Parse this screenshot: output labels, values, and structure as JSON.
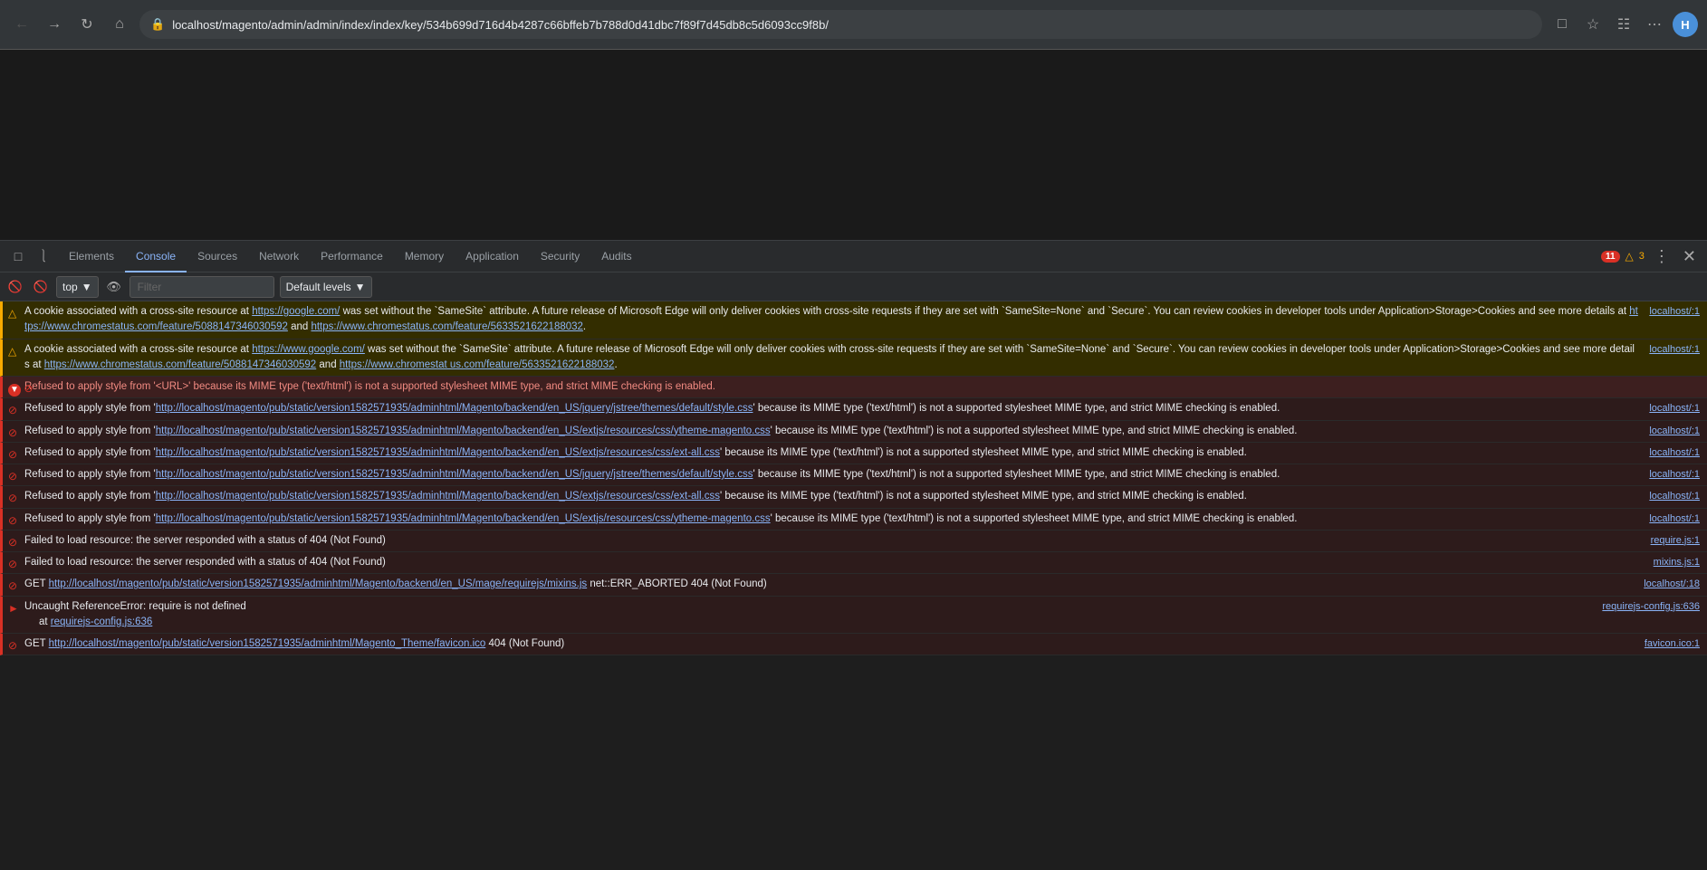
{
  "browser": {
    "url": "localhost/magento/admin/admin/index/index/key/534b699d716d4b4287c66bffeb7b788d0d41dbc7f89f7d45db8c5d6093cc9f8b/",
    "nav_back_title": "Back",
    "nav_forward_title": "Forward",
    "nav_reload_title": "Reload",
    "nav_home_title": "Home"
  },
  "devtools": {
    "tabs": [
      {
        "id": "elements",
        "label": "Elements",
        "active": false
      },
      {
        "id": "console",
        "label": "Console",
        "active": true
      },
      {
        "id": "sources",
        "label": "Sources",
        "active": false
      },
      {
        "id": "network",
        "label": "Network",
        "active": false
      },
      {
        "id": "performance",
        "label": "Performance",
        "active": false
      },
      {
        "id": "memory",
        "label": "Memory",
        "active": false
      },
      {
        "id": "application",
        "label": "Application",
        "active": false
      },
      {
        "id": "security",
        "label": "Security",
        "active": false
      },
      {
        "id": "audits",
        "label": "Audits",
        "active": false
      }
    ],
    "error_count": "11",
    "warn_count": "3",
    "console_context": "top",
    "filter_placeholder": "Filter",
    "level_label": "Default levels",
    "messages": [
      {
        "type": "warn",
        "content": "A cookie associated with a cross-site resource at ",
        "link1": "https://google.com/",
        "mid1": " was set without the `SameSite` attribute. A future release of Microsoft Edge will only deliver cookies with cross-site requests if they are set with `SameSite=None` and `Secure`. You can review cookies in developer tools under Application>Storage>Cookies and see more details at ",
        "link2": "https://www.chromestatus.com/feature/5088147346030592",
        "mid2": " and ",
        "link3": "https://www.chromestatus.com/feature/5633521622188032",
        "end": ".",
        "source": "localhost/:1"
      },
      {
        "type": "warn",
        "content": "A cookie associated with a cross-site resource at ",
        "link1": "https://www.google.com/",
        "mid1": " was set without the `SameSite` attribute. A future release of Microsoft Edge will only deliver cookies with cross-site requests if they are set with `SameSite=None` and `Secure`. You can review cookies in developer tools under Application>Storage>Cookies and see more details at ",
        "link2": "https://www.chromestatus.com/feature/5088147346030592",
        "mid2": " and ",
        "link3": "https://www.chromestatus.com/feature/5633521622188032",
        "end": ".",
        "source": "localhost/:1"
      },
      {
        "type": "error-highlight",
        "icon": "⊗",
        "content": "Refused to apply style from '<URL>' because its MIME type ('text/html') is not a supported stylesheet MIME type, and strict MIME checking is enabled.",
        "source": ""
      },
      {
        "type": "error",
        "icon": "⊗",
        "content": "Refused to apply style from 'http://localhost/magento/pub/static/version1582571935/adminhtml/Magento/backend/en_US/jquery/jstree/themes/default/style.css' because its MIME type ('text/html') is not a supported stylesheet MIME type, and strict MIME checking is enabled.",
        "source": "localhost/:1"
      },
      {
        "type": "error",
        "icon": "⊗",
        "content": "Refused to apply style from 'http://localhost/magento/pub/static/version1582571935/adminhtml/Magento/backend/en_US/extjs/resources/css/ytheme-magento.css' because its MIME type ('text/html') is not a supported stylesheet MIME type, and strict MIME checking is enabled.",
        "source": "localhost/:1"
      },
      {
        "type": "error",
        "icon": "⊗",
        "content": "Refused to apply style from 'http://localhost/magento/pub/static/version1582571935/adminhtml/Magento/backend/en_US/extjs/resources/css/ext-all.css' because its MIME type ('text/html') is not a supported stylesheet MIME type, and strict MIME checking is enabled.",
        "source": "localhost/:1"
      },
      {
        "type": "error",
        "icon": "⊗",
        "content": "Refused to apply style from 'http://localhost/magento/pub/static/version1582571935/adminhtml/Magento/backend/en_US/jquery/jstree/themes/default/style.css' because its MIME type ('text/html') is not a supported stylesheet MIME type, and strict MIME checking is enabled.",
        "source": "localhost/:1"
      },
      {
        "type": "error",
        "icon": "⊗",
        "content": "Refused to apply style from 'http://localhost/magento/pub/static/version1582571935/adminhtml/Magento/backend/en_US/extjs/resources/css/ext-all.css' because its MIME type ('text/html') is not a supported stylesheet MIME type, and strict MIME checking is enabled.",
        "source": "localhost/:1"
      },
      {
        "type": "error",
        "icon": "⊗",
        "content": "Refused to apply style from 'http://localhost/magento/pub/static/version1582571935/adminhtml/Magento/backend/en_US/extjs/resources/css/ytheme-magento.css' because its MIME type ('text/html') is not a supported stylesheet MIME type, and strict MIME checking is enabled.",
        "source": "localhost/:1"
      },
      {
        "type": "error",
        "icon": "⊗",
        "content": "Failed to load resource: the server responded with a status of 404 (Not Found)",
        "source": "require.js:1"
      },
      {
        "type": "error",
        "icon": "⊗",
        "content": "Failed to load resource: the server responded with a status of 404 (Not Found)",
        "source": "mixins.js:1"
      },
      {
        "type": "error",
        "icon": "⊗",
        "content": "GET http://localhost/magento/pub/static/version1582571935/adminhtml/Magento/backend/en_US/mage/requirejs/mixins.js net::ERR_ABORTED 404 (Not Found)",
        "source": "localhost/:18"
      },
      {
        "type": "error-expand",
        "icon": "▶",
        "content": "Uncaught ReferenceError: require is not defined",
        "source": "requirejs-config.js:636",
        "sub": "at requirejs-config.js:636"
      },
      {
        "type": "error",
        "icon": "⊗",
        "content": "GET http://localhost/magento/pub/static/version1582571935/adminhtml/Magento_Theme/favicon.ico 404 (Not Found)",
        "source": "favicon.ico:1"
      }
    ]
  }
}
